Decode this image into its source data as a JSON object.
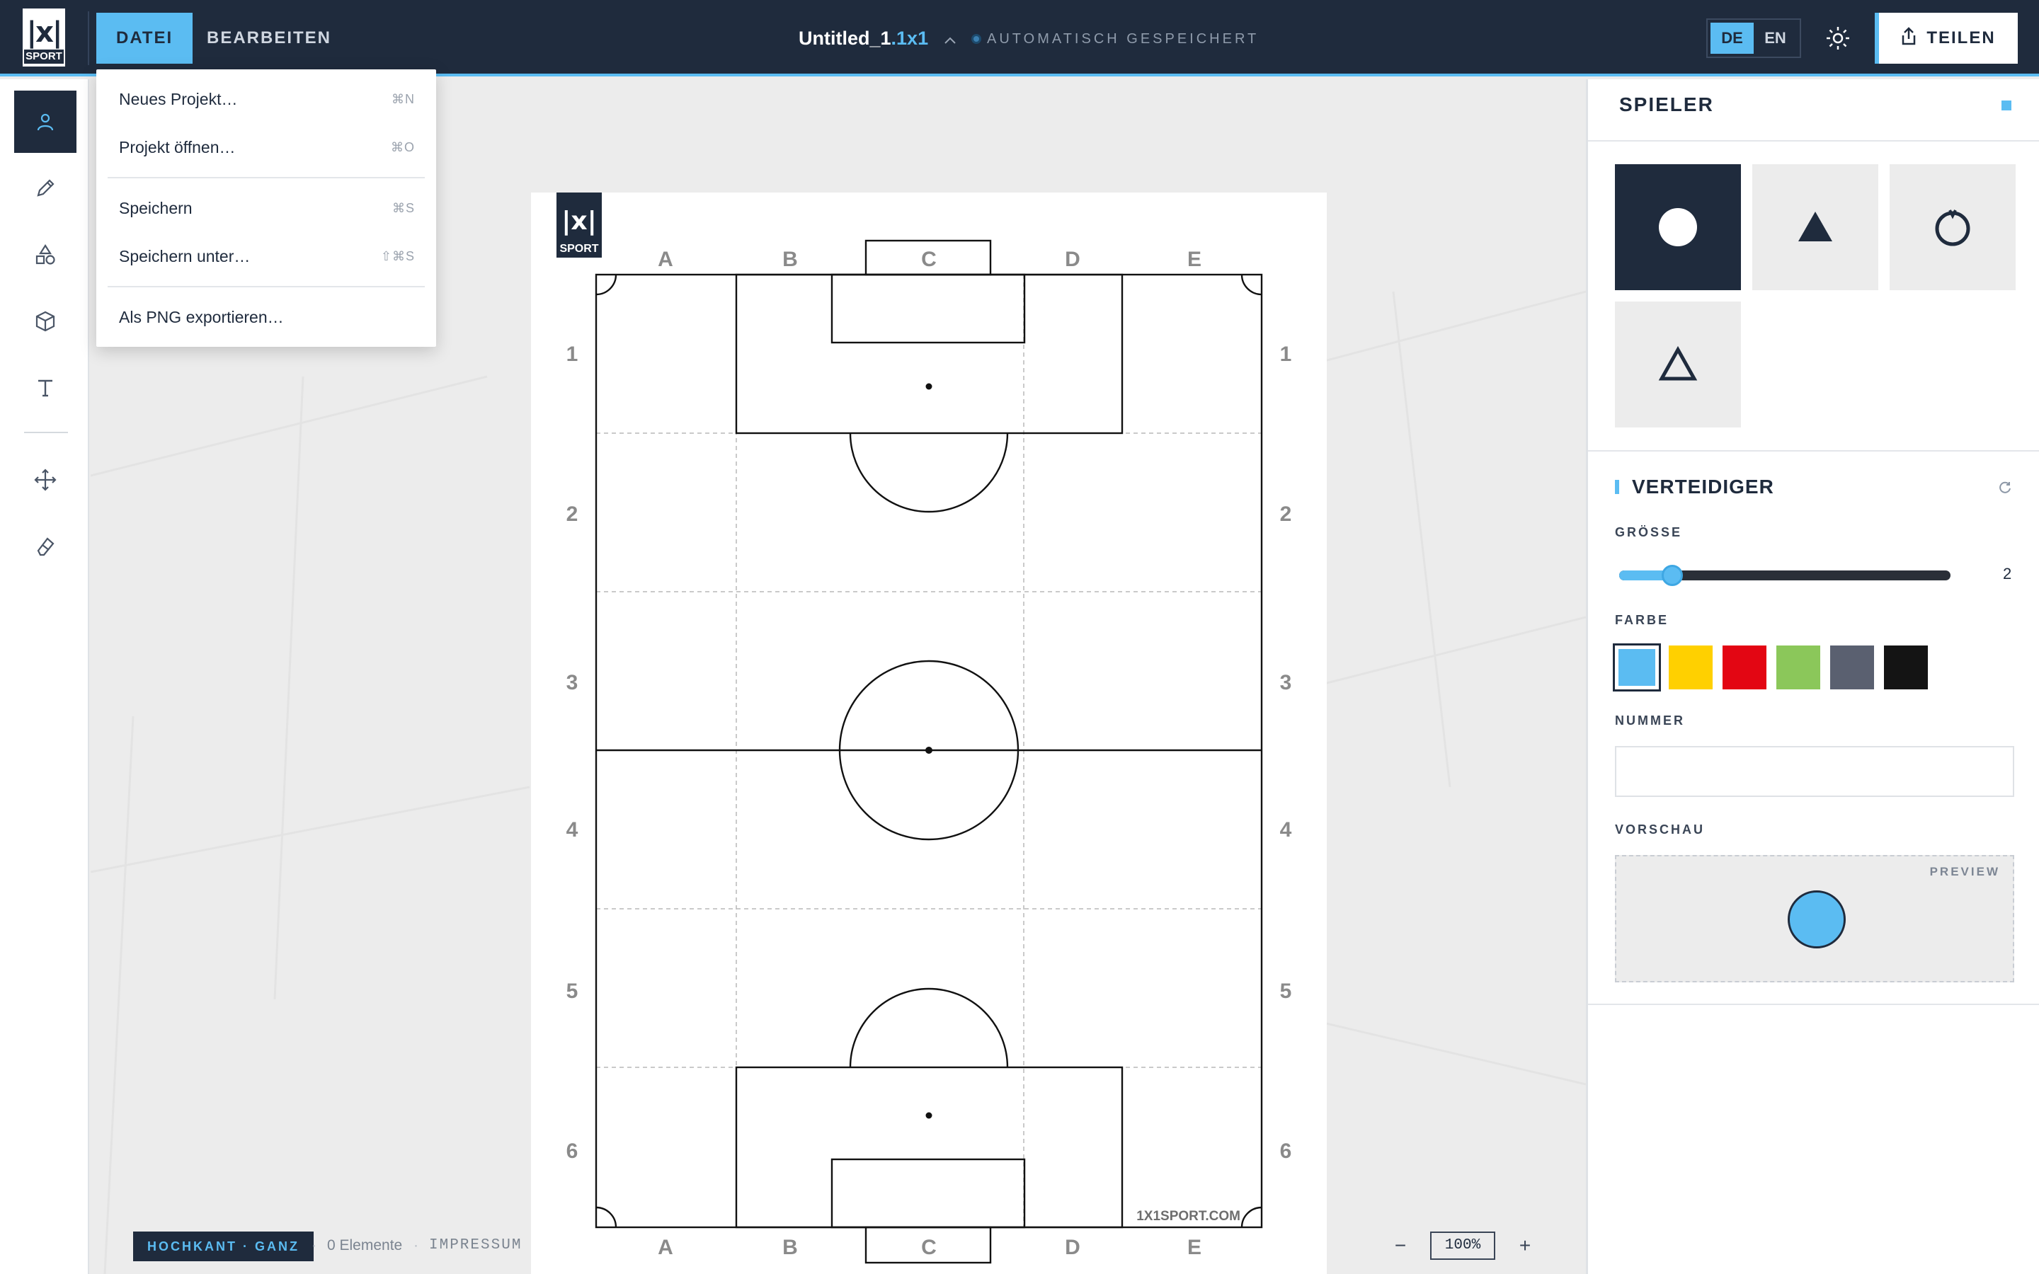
{
  "app": {
    "logo_mark": "|x|",
    "logo_word": "SPORT"
  },
  "menu": {
    "tabs": [
      {
        "label": "DATEI",
        "active": true
      },
      {
        "label": "BEARBEITEN",
        "active": false
      }
    ]
  },
  "document": {
    "name": "Untitled_1",
    "extension": ".1x1",
    "caret": "^",
    "save_status": "AUTOMATISCH GESPEICHERT"
  },
  "language": {
    "options": [
      "DE",
      "EN"
    ],
    "selected": "DE"
  },
  "share": {
    "label": "TEILEN"
  },
  "tools": [
    {
      "icon": "person-icon",
      "active": true
    },
    {
      "icon": "pencil-icon",
      "active": false
    },
    {
      "icon": "shapes-icon",
      "active": false
    },
    {
      "icon": "cube-icon",
      "active": false
    },
    {
      "icon": "text-icon",
      "active": false
    },
    {
      "icon": "move-icon",
      "active": false
    },
    {
      "icon": "eraser-icon",
      "active": false
    }
  ],
  "file_menu": {
    "items": [
      {
        "label": "Neues Projekt…",
        "shortcut": "⌘N"
      },
      {
        "label": "Projekt öffnen…",
        "shortcut": "⌘O"
      },
      {
        "label": "Speichern",
        "shortcut": "⌘S"
      },
      {
        "label": "Speichern unter…",
        "shortcut": "⇧⌘S"
      },
      {
        "label": "Als PNG exportieren…",
        "shortcut": ""
      }
    ]
  },
  "pitch": {
    "logo_mark": "|x|",
    "logo_word": "SPORT",
    "columns": [
      "A",
      "B",
      "C",
      "D",
      "E"
    ],
    "rows": [
      "1",
      "2",
      "3",
      "4",
      "5",
      "6"
    ],
    "watermark": "1X1SPORT.COM"
  },
  "panel": {
    "title": "SPIELER",
    "shapes": [
      {
        "icon": "filled-circle-icon",
        "selected": true
      },
      {
        "icon": "filled-triangle-icon",
        "selected": false
      },
      {
        "icon": "ring-circle-icon",
        "selected": false
      },
      {
        "icon": "outline-triangle-icon",
        "selected": false
      }
    ],
    "section_title": "VERTEIDIGER",
    "size_label": "GRÖSSE",
    "size_value": "2",
    "size_fraction": 0.16,
    "color_label": "FARBE",
    "colors": [
      "#5bbcf2",
      "#ffd000",
      "#e30613",
      "#8bc75a",
      "#5a6070",
      "#141414"
    ],
    "selected_color": "#5bbcf2",
    "number_label": "NUMMER",
    "number_value": "",
    "preview_label": "VORSCHAU",
    "preview_tag": "PREVIEW"
  },
  "status": {
    "orientation": "HOCHKANT · GANZ",
    "elements": "0 Elemente",
    "imprint": "IMPRESSUM",
    "zoom": "100%",
    "zoom_minus": "−",
    "zoom_plus": "+"
  },
  "colors": {
    "navy": "#1f2b3d",
    "accent": "#5bbcf2"
  }
}
